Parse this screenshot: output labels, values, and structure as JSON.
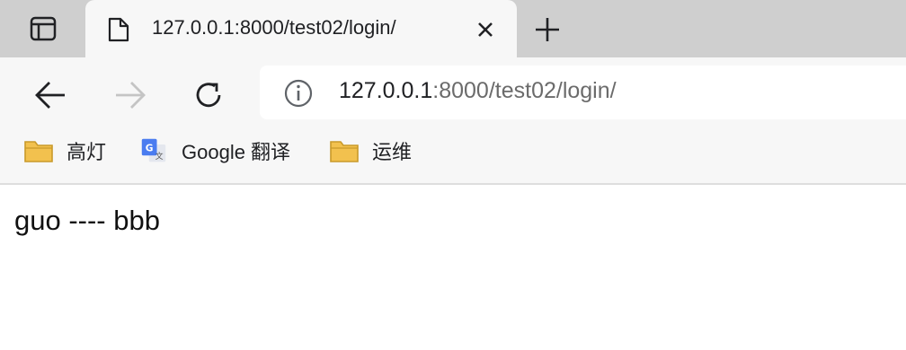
{
  "browser": {
    "tab": {
      "title": "127.0.0.1:8000/test02/login/"
    },
    "address_bar": {
      "host": "127.0.0.1",
      "rest": ":8000/test02/login/"
    },
    "bookmarks": [
      {
        "label": "高灯",
        "icon": "folder-icon"
      },
      {
        "label": "Google 翻译",
        "icon": "google-translate-icon"
      },
      {
        "label": "运维",
        "icon": "folder-icon"
      }
    ]
  },
  "page": {
    "text": "guo ---- bbb"
  },
  "colors": {
    "tabstrip": "#cfcfcf",
    "toolbar": "#f7f7f7",
    "folder": "#f2c14e",
    "translate_blue": "#4a7cf0"
  }
}
